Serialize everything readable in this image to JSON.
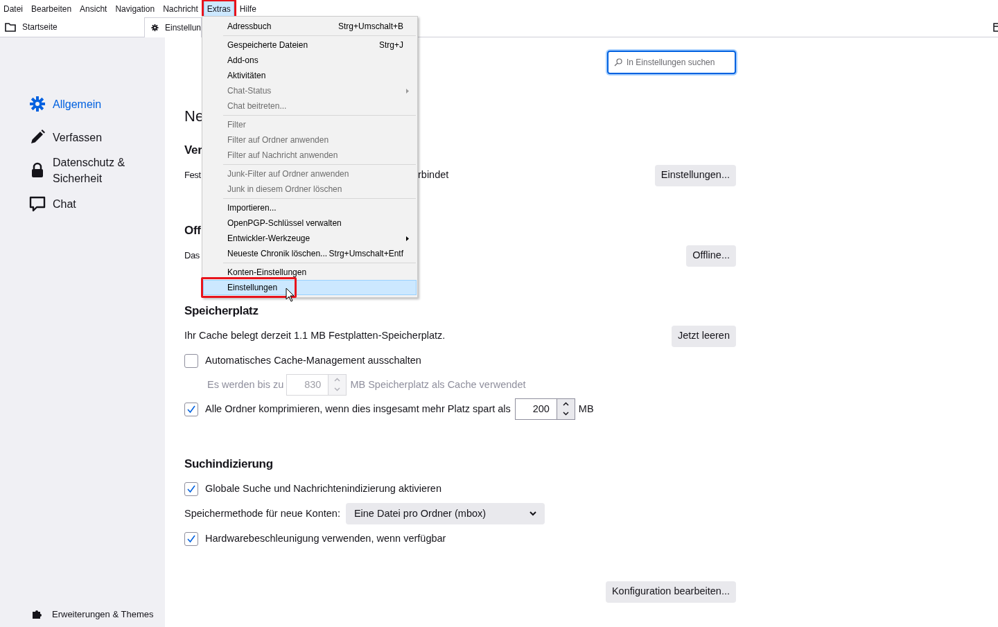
{
  "menubar": [
    {
      "label": "Datei",
      "selected": false,
      "highlighted": false
    },
    {
      "label": "Bearbeiten",
      "selected": false,
      "highlighted": false
    },
    {
      "label": "Ansicht",
      "selected": false,
      "highlighted": false
    },
    {
      "label": "Navigation",
      "selected": false,
      "highlighted": false
    },
    {
      "label": "Nachricht",
      "selected": false,
      "highlighted": false
    },
    {
      "label": "Extras",
      "selected": true,
      "highlighted": true
    },
    {
      "label": "Hilfe",
      "selected": false,
      "highlighted": false
    }
  ],
  "tabs": [
    {
      "kind": "folder",
      "label": "Startseite",
      "selected": false
    },
    {
      "kind": "settings",
      "label": "Einstellun",
      "selected": true
    }
  ],
  "extras_menu": [
    {
      "kind": "item",
      "label": "Adressbuch",
      "shortcut": "Strg+Umschalt+B",
      "disabled": false,
      "submenu": false,
      "selected": false,
      "highlighted": false
    },
    {
      "kind": "separator"
    },
    {
      "kind": "item",
      "label": "Gespeicherte Dateien",
      "shortcut": "Strg+J",
      "disabled": false,
      "submenu": false,
      "selected": false,
      "highlighted": false
    },
    {
      "kind": "item",
      "label": "Add-ons",
      "disabled": false,
      "submenu": false,
      "selected": false,
      "highlighted": false
    },
    {
      "kind": "item",
      "label": "Aktivitäten",
      "disabled": false,
      "submenu": false,
      "selected": false,
      "highlighted": false
    },
    {
      "kind": "item",
      "label": "Chat-Status",
      "disabled": true,
      "submenu": true,
      "selected": false,
      "highlighted": false
    },
    {
      "kind": "item",
      "label": "Chat beitreten...",
      "disabled": true,
      "submenu": false,
      "selected": false,
      "highlighted": false
    },
    {
      "kind": "separator"
    },
    {
      "kind": "item",
      "label": "Filter",
      "disabled": true,
      "submenu": false,
      "selected": false,
      "highlighted": false
    },
    {
      "kind": "item",
      "label": "Filter auf Ordner anwenden",
      "disabled": true,
      "submenu": false,
      "selected": false,
      "highlighted": false
    },
    {
      "kind": "item",
      "label": "Filter auf Nachricht anwenden",
      "disabled": true,
      "submenu": false,
      "selected": false,
      "highlighted": false
    },
    {
      "kind": "separator"
    },
    {
      "kind": "item",
      "label": "Junk-Filter auf Ordner anwenden",
      "disabled": true,
      "submenu": false,
      "selected": false,
      "highlighted": false
    },
    {
      "kind": "item",
      "label": "Junk in diesem Ordner löschen",
      "disabled": true,
      "submenu": false,
      "selected": false,
      "highlighted": false
    },
    {
      "kind": "separator"
    },
    {
      "kind": "item",
      "label": "Importieren...",
      "disabled": false,
      "submenu": false,
      "selected": false,
      "highlighted": false
    },
    {
      "kind": "item",
      "label": "OpenPGP-Schlüssel verwalten",
      "disabled": false,
      "submenu": false,
      "selected": false,
      "highlighted": false
    },
    {
      "kind": "item",
      "label": "Entwickler-Werkzeuge",
      "disabled": false,
      "submenu": true,
      "selected": false,
      "highlighted": false
    },
    {
      "kind": "item",
      "label": "Neueste Chronik löschen...",
      "shortcut": "Strg+Umschalt+Entf",
      "disabled": false,
      "submenu": false,
      "selected": false,
      "highlighted": false
    },
    {
      "kind": "separator"
    },
    {
      "kind": "item",
      "label": "Konten-Einstellungen",
      "disabled": false,
      "submenu": false,
      "selected": false,
      "highlighted": false
    },
    {
      "kind": "item",
      "label": "Einstellungen",
      "disabled": false,
      "submenu": false,
      "selected": true,
      "highlighted": true
    }
  ],
  "sidebar": {
    "items": [
      {
        "kind": "gear",
        "label": "Allgemein",
        "selected": true
      },
      {
        "kind": "pen",
        "label": "Verfassen",
        "selected": false
      },
      {
        "kind": "lock",
        "label": "Datenschutz & Sicherheit",
        "selected": false
      },
      {
        "kind": "chat",
        "label": "Chat",
        "selected": false
      }
    ],
    "footer": "Erweiterungen & Themes"
  },
  "search": {
    "placeholder": "In Einstellungen suchen"
  },
  "rows": [
    {
      "kind": "page_title",
      "text": "Ne"
    },
    {
      "kind": "section",
      "text": "Ver"
    },
    {
      "kind": "text_button",
      "text": "Fest",
      "text_after": "rbindet",
      "button": "Einstellungen..."
    },
    {
      "kind": "section",
      "text": "Off"
    },
    {
      "kind": "text_button",
      "text": "Das",
      "button": "Offline..."
    },
    {
      "kind": "section",
      "text": "Speicherplatz"
    },
    {
      "kind": "text_button",
      "text": "Ihr Cache belegt derzeit 1.1 MB Festplatten-Speicherplatz.",
      "button": "Jetzt leeren"
    },
    {
      "kind": "checkbox",
      "label": "Automatisches Cache-Management ausschalten",
      "checked": false
    },
    {
      "kind": "number",
      "label": "Es werden bis zu",
      "value": "830",
      "unit": "MB Speicherplatz als Cache verwendet",
      "disabled": true
    },
    {
      "kind": "checkbox",
      "label": "Alle Ordner komprimieren, wenn dies insgesamt mehr Platz spart als",
      "checked": true,
      "value": "200",
      "unit": "MB"
    },
    {
      "kind": "section",
      "text": "Suchindizierung"
    },
    {
      "kind": "checkbox",
      "label": "Globale Suche und Nachrichtenindizierung aktivieren",
      "checked": true
    },
    {
      "kind": "select",
      "label": "Speichermethode für neue Konten:",
      "value": "Eine Datei pro Ordner (mbox)"
    },
    {
      "kind": "checkbox",
      "label": "Hardwarebeschleunigung verwenden, wenn verfügbar",
      "checked": true
    },
    {
      "kind": "button_row",
      "button": "Konfiguration bearbeiten..."
    }
  ]
}
